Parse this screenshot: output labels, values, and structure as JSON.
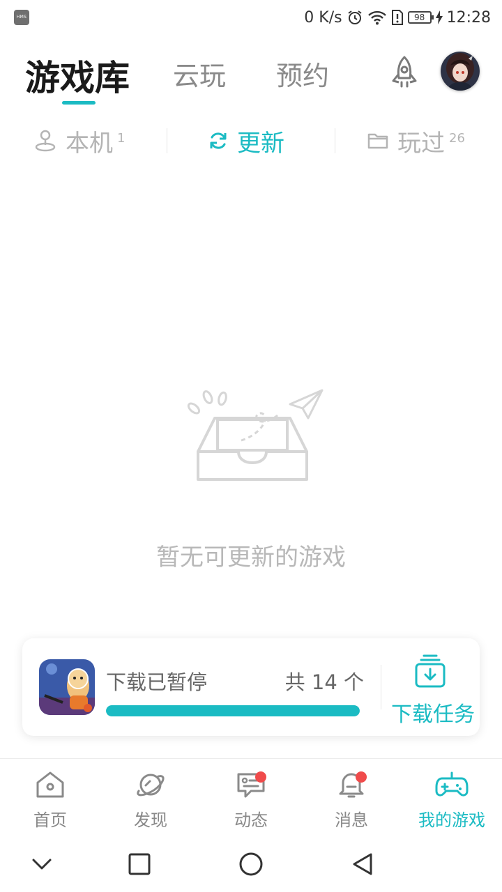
{
  "status_bar": {
    "hms": "HMS",
    "net_speed": "0 K/s",
    "battery": "98",
    "time": "12:28"
  },
  "header": {
    "tabs": [
      {
        "label": "游戏库",
        "active": true
      },
      {
        "label": "云玩",
        "active": false
      },
      {
        "label": "预约",
        "active": false
      }
    ],
    "rocket_icon": "rocket-icon",
    "accent_color": "#1bbbc3"
  },
  "subtabs": [
    {
      "label": "本机",
      "count": "1",
      "icon": "joystick-icon"
    },
    {
      "label": "更新",
      "count": "",
      "icon": "refresh-icon",
      "active": true
    },
    {
      "label": "玩过",
      "count": "26",
      "icon": "folder-icon"
    }
  ],
  "empty_state": {
    "illustration": "empty-inbox-paper-plane",
    "text": "暂无可更新的游戏"
  },
  "download_card": {
    "status": "下载已暂停",
    "total": "共 14 个",
    "progress": 1.0,
    "task_label": "下载任务"
  },
  "bottom_nav": [
    {
      "label": "首页",
      "icon": "home-icon",
      "badge": false
    },
    {
      "label": "发现",
      "icon": "planet-icon",
      "badge": false
    },
    {
      "label": "动态",
      "icon": "chat-card-icon",
      "badge": true
    },
    {
      "label": "消息",
      "icon": "bell-icon",
      "badge": true
    },
    {
      "label": "我的游戏",
      "icon": "gamepad-icon",
      "badge": false,
      "active": true
    }
  ]
}
